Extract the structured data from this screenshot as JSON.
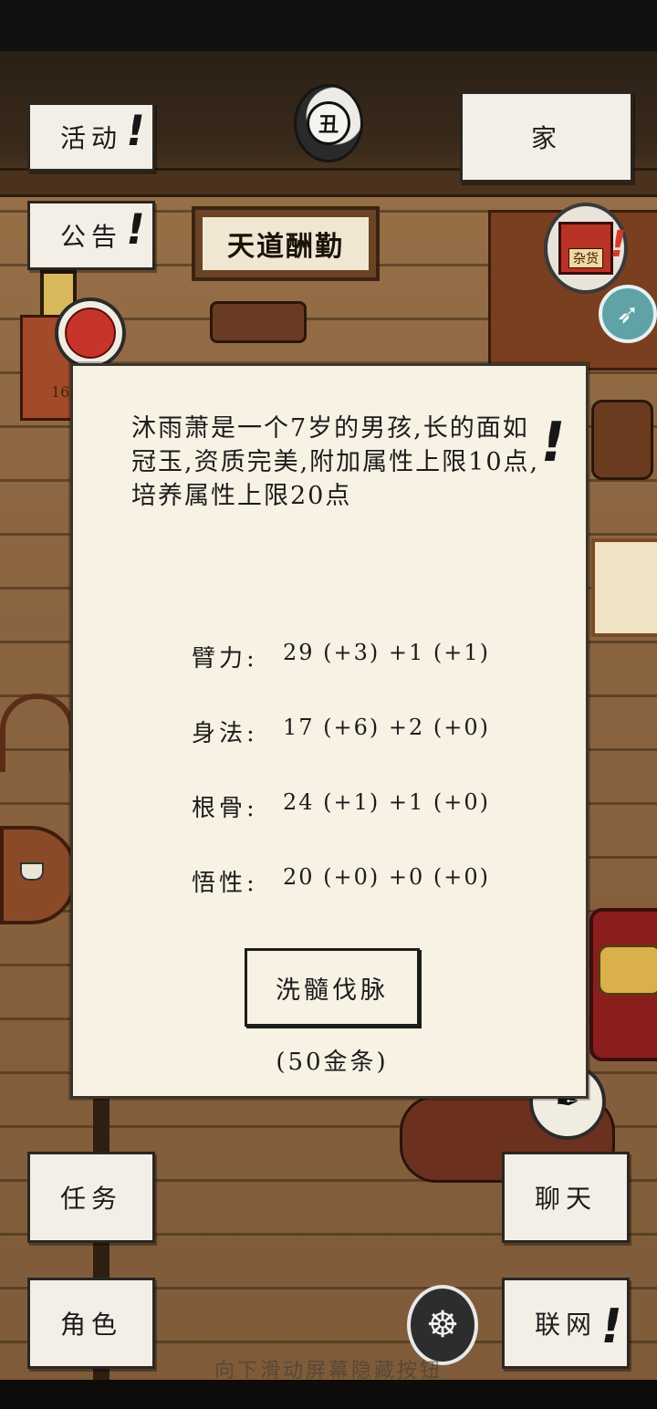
{
  "top_left_buttons": [
    {
      "label": "活动",
      "has_alert": true
    },
    {
      "label": "公告",
      "has_alert": true
    }
  ],
  "top_right_button": {
    "label": "家"
  },
  "time_icon": {
    "text": "丑"
  },
  "plaque": {
    "text": "天道酬勤"
  },
  "shop_icon": {
    "sign": "杂货"
  },
  "gold_partial": "16",
  "dialog": {
    "description": "沐雨萧是一个7岁的男孩,长的面如冠玉,资质完美,附加属性上限10点,培养属性上限20点",
    "stats": [
      {
        "label": "臂力:",
        "value": "29 (+3) +1 (+1)"
      },
      {
        "label": "身法:",
        "value": "17 (+6) +2 (+0)"
      },
      {
        "label": "根骨:",
        "value": "24 (+1) +1 (+0)"
      },
      {
        "label": "悟性:",
        "value": "20 (+0) +0 (+0)"
      }
    ],
    "action_button": "洗髓伐脉",
    "cost": "(50金条)"
  },
  "bottom_buttons": {
    "tasks": "任务",
    "chat": "聊天",
    "role": "角色",
    "network": "联网"
  },
  "hint_text": "向下滑动屏幕隐藏按钮",
  "icons": [
    "time-icon",
    "shop-icon",
    "rocket-icon",
    "bag-icon",
    "meditation-icon"
  ]
}
